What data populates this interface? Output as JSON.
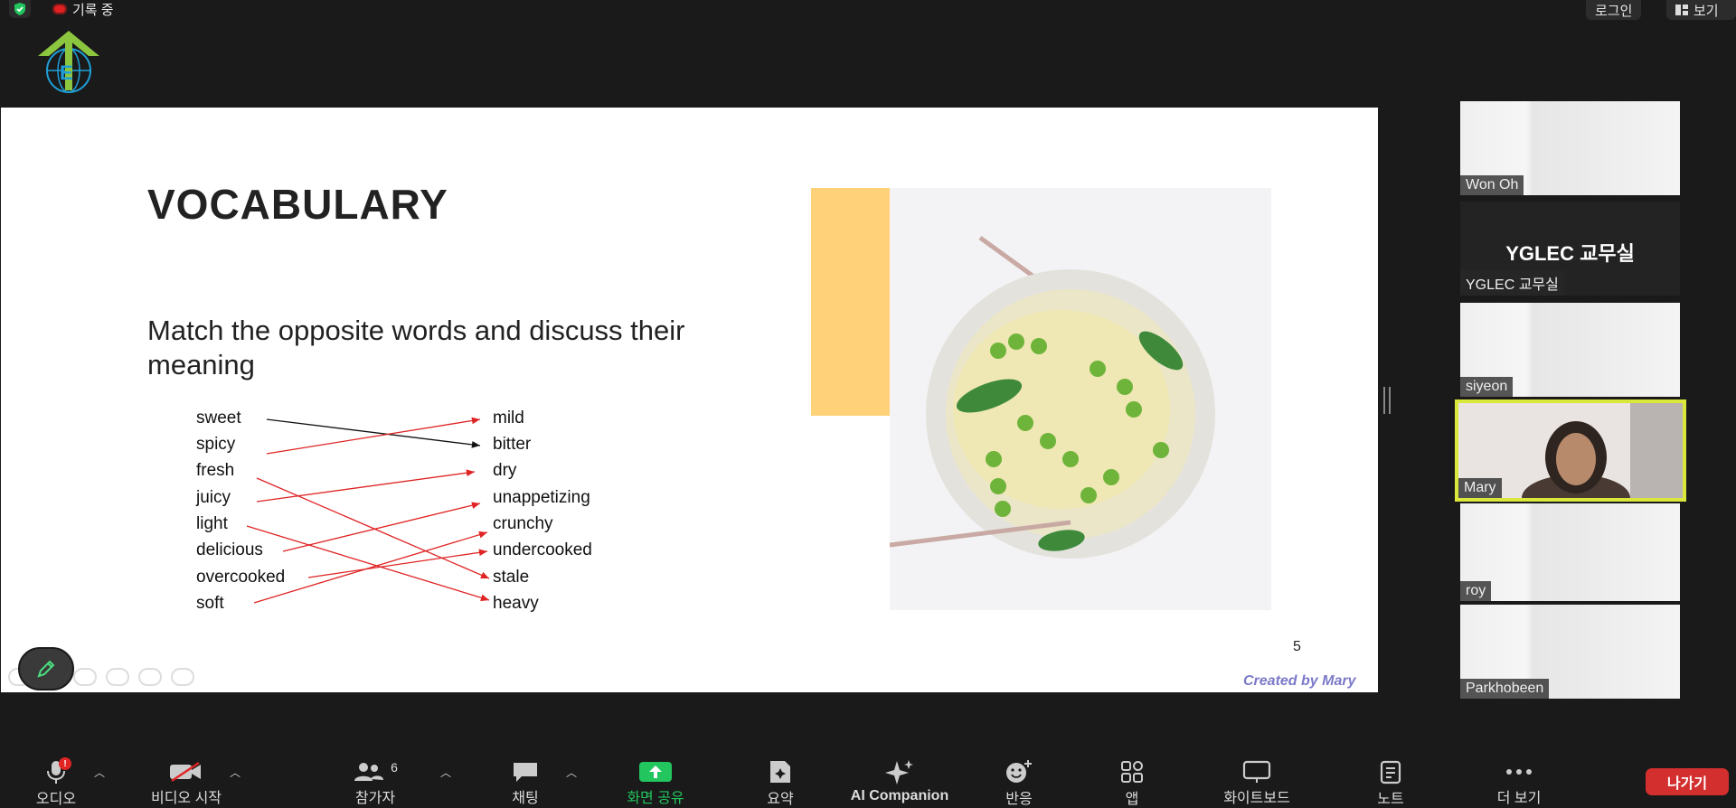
{
  "topbar": {
    "recording_label": "기록 중",
    "login_label": "로그인",
    "view_label": "보기"
  },
  "slide": {
    "title": "VOCABULARY",
    "subtitle": "Match the opposite words and discuss their meaning",
    "left_words": [
      "sweet",
      "spicy",
      "fresh",
      "juicy",
      "light",
      "delicious",
      "overcooked",
      "soft"
    ],
    "right_words": [
      "mild",
      "bitter",
      "dry",
      "unappetizing",
      "crunchy",
      "undercooked",
      "stale",
      "heavy"
    ],
    "page_number": "5",
    "credit": "Created by Mary"
  },
  "participants": [
    {
      "name": "Won Oh"
    },
    {
      "name": "YGLEC 교무실",
      "display": "YGLEC 교무실"
    },
    {
      "name": "siyeon"
    },
    {
      "name": "Mary"
    },
    {
      "name": "roy"
    },
    {
      "name": "Parkhobeen"
    }
  ],
  "toolbar": {
    "audio": "오디오",
    "video": "비디오 시작",
    "participants": "참가자",
    "participant_count": "6",
    "chat": "채팅",
    "share": "화면 공유",
    "summary": "요약",
    "companion": "AI Companion",
    "reactions": "반응",
    "apps": "앱",
    "whiteboard": "화이트보드",
    "notes": "노트",
    "more": "더 보기",
    "leave": "나가기"
  },
  "colors": {
    "share_green": "#22c55e",
    "leave_red": "#d32f2f",
    "active_border": "#d9e83a",
    "match_line": "#e02424"
  }
}
